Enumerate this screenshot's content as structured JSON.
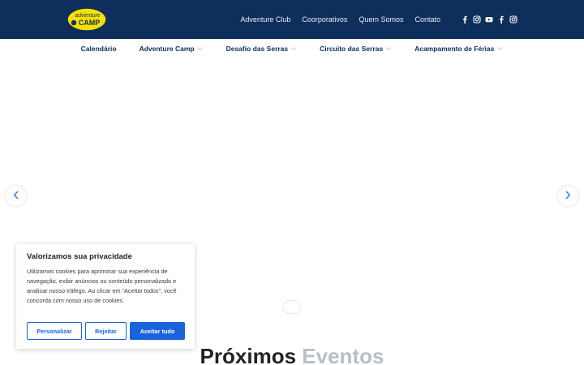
{
  "header": {
    "logo": {
      "line1": "adventure",
      "line2": "CAMP",
      "colors": {
        "fill": "#f5e000",
        "text": "#0e2e5c"
      }
    },
    "links": [
      "Adventure Club",
      "Coorporativos",
      "Quem Somos",
      "Contato"
    ],
    "socials": [
      {
        "icon": "facebook-icon"
      },
      {
        "icon": "instagram-icon"
      },
      {
        "icon": "youtube-icon"
      },
      {
        "icon": "facebook-icon"
      },
      {
        "icon": "instagram-icon"
      }
    ],
    "background": "#0e2e5c"
  },
  "subnav": {
    "items": [
      {
        "label": "Calendário",
        "dropdown": false
      },
      {
        "label": "Adventure Camp",
        "dropdown": true
      },
      {
        "label": "Desafio das Serras",
        "dropdown": true
      },
      {
        "label": "Circuito das Serras",
        "dropdown": true
      },
      {
        "label": "Acampamento de Férias",
        "dropdown": true
      }
    ]
  },
  "carousel": {
    "prev_icon": "chevron-left-icon",
    "next_icon": "chevron-right-icon",
    "accent": "#2a6fd6"
  },
  "section": {
    "heading_part1": "Próximos",
    "heading_part2": "Eventos"
  },
  "cookie_banner": {
    "title": "Valorizamos sua privacidade",
    "text": "Utilizamos cookies para aprimorar sua experiência de navegação, exibir anúncios ou conteúdo personalizado e analisar nosso tráfego. Ao clicar em “Aceitar todos”, você concorda com nosso uso de cookies.",
    "buttons": {
      "customize": "Personalizar",
      "reject": "Rejeitar",
      "accept": "Aceitar tudo"
    },
    "accent": "#1863dc"
  }
}
